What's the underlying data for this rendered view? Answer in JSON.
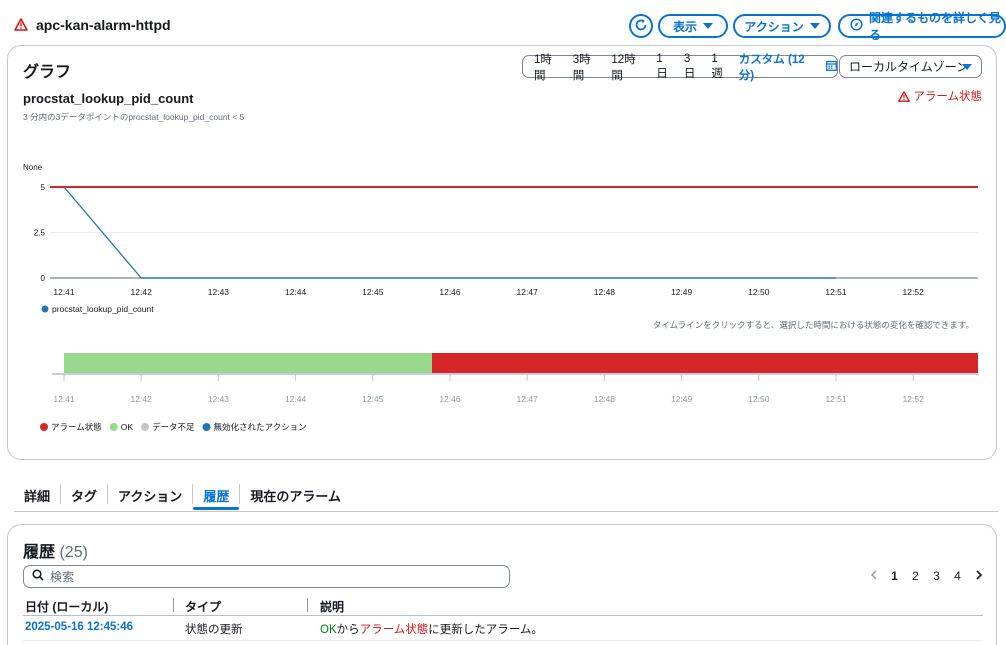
{
  "header": {
    "title": "apc-kan-alarm-httpd",
    "view_label": "表示",
    "action_label": "アクション",
    "related_label": "関連するものを詳しく見る"
  },
  "graph": {
    "title": "グラフ",
    "ranges": [
      "1時間",
      "3時間",
      "12時間",
      "1日",
      "3日",
      "1週"
    ],
    "custom_range": "カスタム (12分)",
    "timezone": "ローカルタイムゾーン",
    "metric_name": "procstat_lookup_pid_count",
    "condition": "3 分内の3データポイントのprocstat_lookup_pid_count < 5",
    "alarm_status": "アラーム状態",
    "timeline_hint": "タイムラインをクリックすると、選択した時間における状態の変化を確認できます。"
  },
  "chart_data": [
    {
      "type": "line",
      "ylabel": "None",
      "yticks": [
        0,
        2.5,
        5
      ],
      "ylim": [
        0,
        5
      ],
      "x_ticks": [
        "12:41",
        "12:42",
        "12:43",
        "12:44",
        "12:45",
        "12:46",
        "12:47",
        "12:48",
        "12:49",
        "12:50",
        "12:51",
        "12:52"
      ],
      "threshold": 5,
      "series": [
        {
          "name": "procstat_lookup_pid_count",
          "color": "#1f77b4",
          "x": [
            "12:41",
            "12:42",
            "12:43",
            "12:44",
            "12:45",
            "12:46",
            "12:47",
            "12:48",
            "12:49",
            "12:50",
            "12:51"
          ],
          "values": [
            5,
            0,
            0,
            0,
            0,
            0,
            0,
            0,
            0,
            0,
            0
          ]
        }
      ],
      "threshold_color": "#d62728",
      "grid": true,
      "legend": "bottom-left"
    },
    {
      "type": "timeline",
      "x_ticks": [
        "12:41",
        "12:42",
        "12:43",
        "12:44",
        "12:45",
        "12:46",
        "12:47",
        "12:48",
        "12:49",
        "12:50",
        "12:51",
        "12:52"
      ],
      "segments": [
        {
          "state": "OK",
          "start": "12:41",
          "end": "12:45:46",
          "color": "#98d98e"
        },
        {
          "state": "アラーム状態",
          "start": "12:45:46",
          "end": "12:53",
          "color": "#d62728"
        }
      ],
      "legend": [
        {
          "label": "アラーム状態",
          "color": "#d62728"
        },
        {
          "label": "OK",
          "color": "#98d98e"
        },
        {
          "label": "データ不足",
          "color": "#c6c6c6"
        },
        {
          "label": "無効化されたアクション",
          "color": "#1f77b4"
        }
      ]
    }
  ],
  "tabs": [
    "詳細",
    "タグ",
    "アクション",
    "履歴",
    "現在のアラーム"
  ],
  "active_tab": "履歴",
  "history": {
    "title": "履歴",
    "count": "(25)",
    "search_placeholder": "検索",
    "pages": [
      "1",
      "2",
      "3",
      "4"
    ],
    "current_page": "1",
    "columns": [
      "日付 (ローカル)",
      "タイプ",
      "説明"
    ],
    "rows": [
      {
        "date": "2025-05-16 12:45:46",
        "type": "状態の更新",
        "desc_ok": "OK",
        "desc_from": "から",
        "desc_alarm": "アラーム状態",
        "desc_rest": "に更新したアラーム。"
      }
    ]
  }
}
